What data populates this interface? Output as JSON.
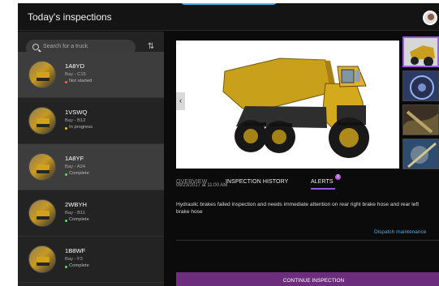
{
  "app": {
    "title": "Today's inspections"
  },
  "sidebar": {
    "search_placeholder": "Search for a truck",
    "icons": {
      "search": "search-icon",
      "sort": "sort-icon"
    },
    "trucks": [
      {
        "id": "1A8YD",
        "bay": "Bay - C15",
        "status": "Not started",
        "status_color": "#ff5b6e"
      },
      {
        "id": "1VSWQ",
        "bay": "Bay - B12",
        "status": "In progress",
        "status_color": "#f0bf26"
      },
      {
        "id": "1A8YF",
        "bay": "Bay - A34",
        "status": "Complete",
        "status_color": "#61d86a"
      },
      {
        "id": "2WBYH",
        "bay": "Bay - B11",
        "status": "Complete",
        "status_color": "#61d86a"
      },
      {
        "id": "1B8WF",
        "bay": "Bay - F3",
        "status": "Complete",
        "status_color": "#61d86a"
      }
    ]
  },
  "main": {
    "tabs": [
      {
        "label": "OVERVIEW"
      },
      {
        "label": "INSPECTION HISTORY"
      },
      {
        "label": "ALERTS",
        "badge": "2"
      }
    ],
    "alert": {
      "date": "09/23/2017 at 11:00 AM",
      "message": "Hydraulic brakes failed inspection and needs immediate attention on rear right brake hose and rear left brake hose"
    },
    "dispatch_label": "Dispatch maintenance",
    "continue_label": "CONTINUE INSPECTION"
  },
  "colors": {
    "accent": "#9d54de",
    "button": "#6d2d7d",
    "link": "#54a9e5"
  }
}
